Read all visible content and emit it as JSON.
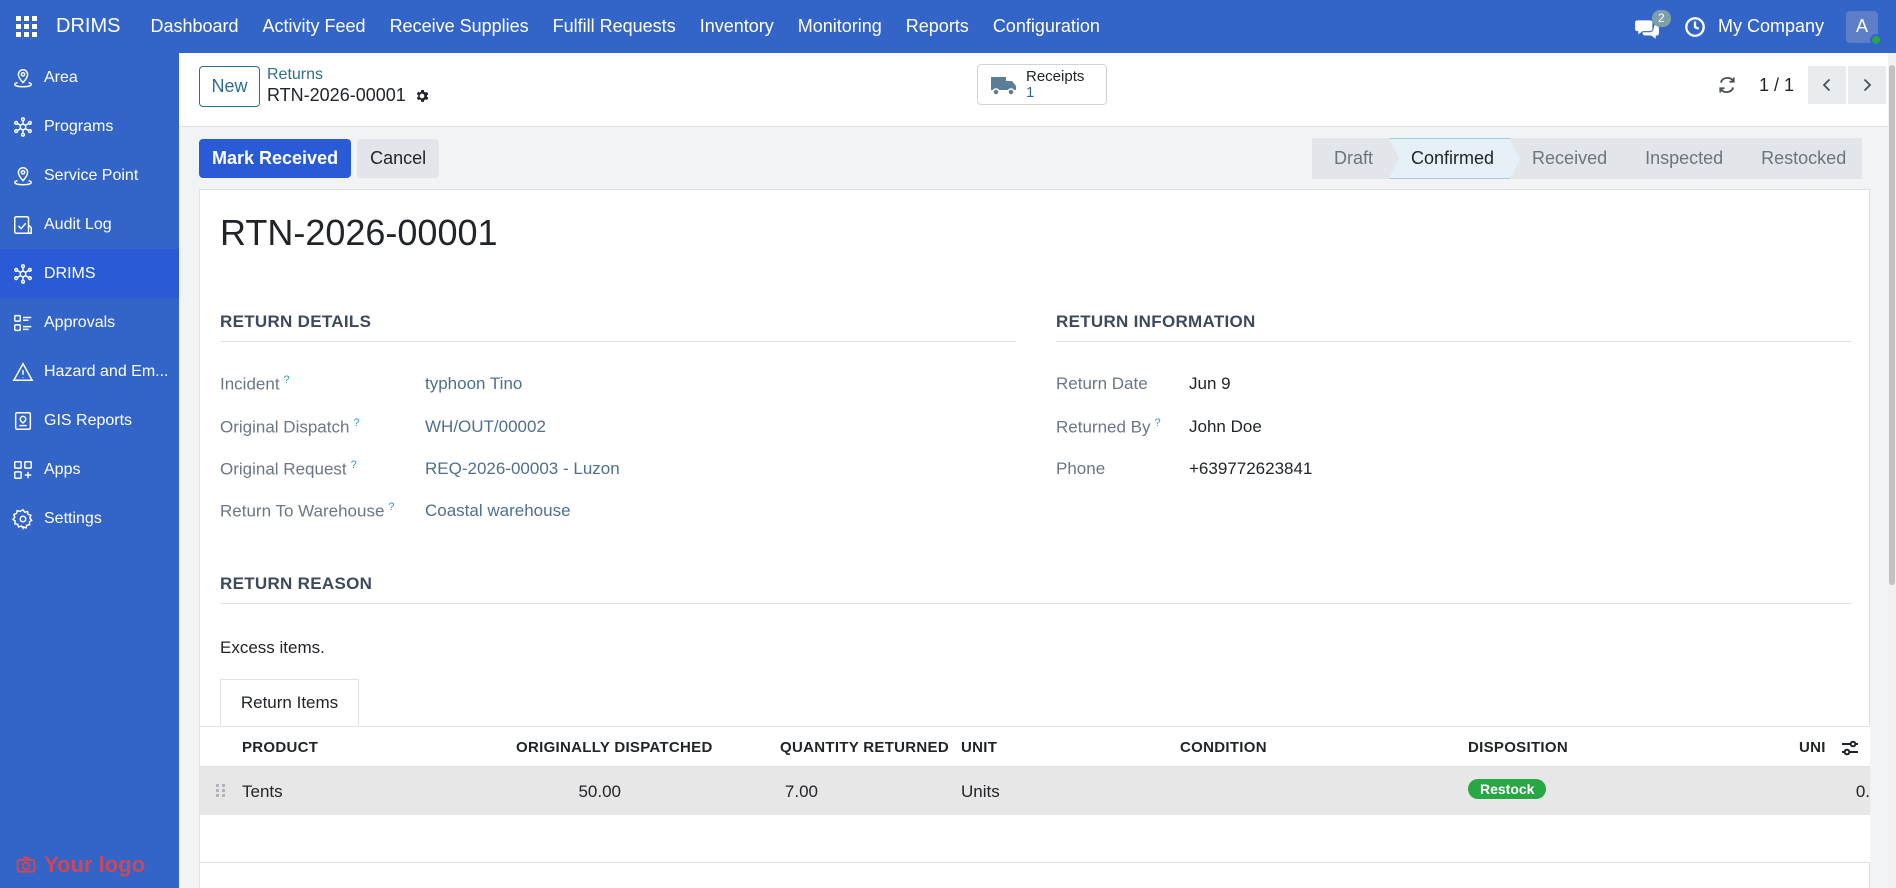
{
  "navbar": {
    "brand": "DRIMS",
    "menu": [
      "Dashboard",
      "Activity Feed",
      "Receive Supplies",
      "Fulfill Requests",
      "Inventory",
      "Monitoring",
      "Reports",
      "Configuration"
    ],
    "chat_badge": "2",
    "company": "My Company",
    "avatar_letter": "A"
  },
  "sidebar": {
    "items": [
      {
        "label": "Area",
        "icon": "map-pin-icon"
      },
      {
        "label": "Programs",
        "icon": "network-icon"
      },
      {
        "label": "Service Point",
        "icon": "map-pin-icon"
      },
      {
        "label": "Audit Log",
        "icon": "audit-icon"
      },
      {
        "label": "DRIMS",
        "icon": "network-icon"
      },
      {
        "label": "Approvals",
        "icon": "list-icon"
      },
      {
        "label": "Hazard and Em...",
        "icon": "warning-icon"
      },
      {
        "label": "GIS Reports",
        "icon": "report-icon"
      },
      {
        "label": "Apps",
        "icon": "apps-icon"
      },
      {
        "label": "Settings",
        "icon": "gear-icon"
      }
    ],
    "logo_text": "Your logo"
  },
  "control": {
    "new_label": "New",
    "breadcrumb_parent": "Returns",
    "breadcrumb_current": "RTN-2026-00001",
    "smart_button_label": "Receipts",
    "smart_button_count": "1",
    "pager": "1 / 1"
  },
  "actions": {
    "mark_received": "Mark Received",
    "cancel": "Cancel"
  },
  "statusbar": {
    "stages": [
      "Draft",
      "Confirmed",
      "Received",
      "Inspected",
      "Restocked"
    ],
    "current": "Confirmed"
  },
  "record": {
    "title": "RTN-2026-00001",
    "details_title": "RETURN DETAILS",
    "info_title": "RETURN INFORMATION",
    "reason_title": "RETURN REASON",
    "details": [
      {
        "label": "Incident",
        "value": "typhoon Tino"
      },
      {
        "label": "Original Dispatch",
        "value": "WH/OUT/00002"
      },
      {
        "label": "Original Request",
        "value": "REQ-2026-00003 - Luzon"
      },
      {
        "label": "Return To Warehouse",
        "value": "Coastal warehouse"
      }
    ],
    "info": [
      {
        "label": "Return Date",
        "value": "Jun 9",
        "help": false
      },
      {
        "label": "Returned By",
        "value": "John Doe",
        "help": true
      },
      {
        "label": "Phone",
        "value": "+639772623841",
        "help": false
      }
    ],
    "reason": "Excess items.",
    "help_mark": "?"
  },
  "tab": {
    "label": "Return Items"
  },
  "table": {
    "headers": [
      "PRODUCT",
      "ORIGINALLY DISPATCHED",
      "QUANTITY RETURNED",
      "UNIT",
      "CONDITION",
      "DISPOSITION",
      "UNI"
    ],
    "rows": [
      {
        "product": "Tents",
        "originally_dispatched": "50.00",
        "quantity_returned": "7.00",
        "unit": "Units",
        "condition": "",
        "disposition": "Restock",
        "unit_cost": "0."
      }
    ]
  },
  "colors": {
    "primary": "#3365c9",
    "accent": "#2a5bd7",
    "link": "#4f708e",
    "success": "#28a745"
  }
}
